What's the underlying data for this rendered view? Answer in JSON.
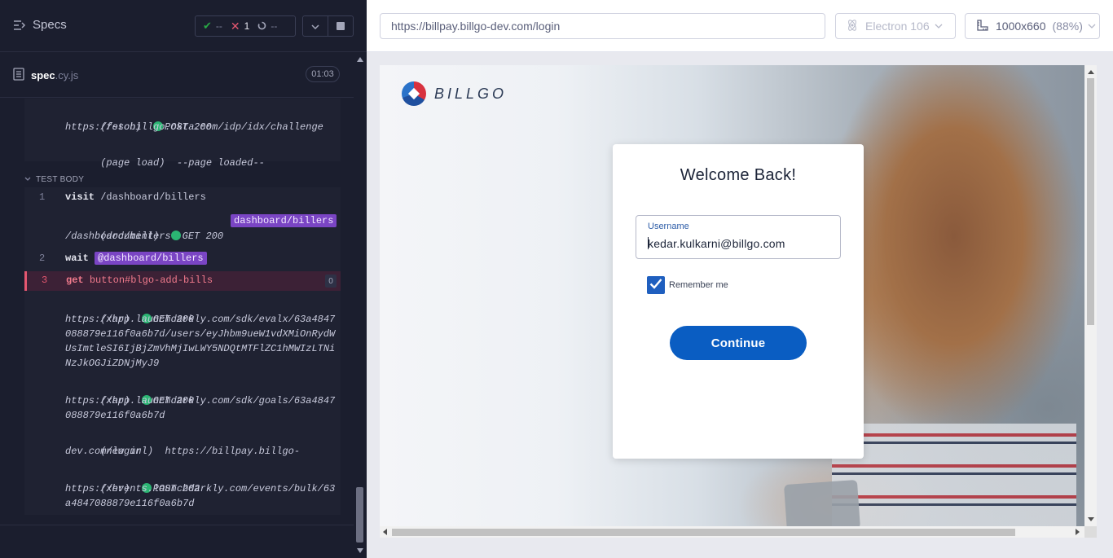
{
  "sidebar": {
    "title": "Specs",
    "stats": {
      "passed": "--",
      "failed": "1",
      "pending": "--"
    },
    "spec": {
      "name": "spec",
      "ext": ".cy.js",
      "duration": "01:03"
    }
  },
  "log": {
    "before": [
      {
        "type": "(fetch)",
        "method": "POST 200",
        "url": "https://ssobillgo.okta.com/idp/idx/challenge"
      },
      {
        "type": "(page load)",
        "message": "--page loaded--"
      }
    ],
    "section": "TEST BODY",
    "steps": [
      {
        "num": "1",
        "cmd": "visit",
        "arg": "/dashboard/billers"
      },
      {
        "type": "(document)",
        "method": "GET 200",
        "url": "/dashboard/billers",
        "alias": "dashboard/billers"
      },
      {
        "num": "2",
        "cmd": "wait",
        "arg": "@dashboard/billers"
      },
      {
        "num": "3",
        "cmd": "get",
        "arg": "button#blgo-add-bills",
        "count": "0",
        "failed": true
      },
      {
        "type": "(xhr)",
        "method": "GET 200",
        "url_lines": [
          "https://app.launchdarkly.com/sdk/evalx/63a4847",
          "088879e116f0a6b7d/users/eyJhbm9ueW1vdXMiOnRydW",
          "UsImtleSI6IjBjZmVhMjIwLWY5NDQtMTFlZC1hMWIzLTNi",
          "NzJkOGJiZDNjMyJ9"
        ]
      },
      {
        "type": "(xhr)",
        "method": "GET 200",
        "url_lines": [
          "https://app.launchdarkly.com/sdk/goals/63a4847",
          "088879e116f0a6b7d"
        ]
      },
      {
        "type": "(new url)",
        "url_lines": [
          "https://billpay.billgo-",
          "dev.com/login"
        ]
      },
      {
        "type": "(xhr)",
        "method": "POST 202",
        "url_lines": [
          "https://events.launchdarkly.com/events/bulk/63",
          "a4847088879e116f0a6b7d"
        ]
      }
    ]
  },
  "browser": {
    "url": "https://billpay.billgo-dev.com/login",
    "name": "Electron 106",
    "viewport": "1000x660",
    "zoom": "(88%)"
  },
  "app": {
    "logo_text": "BILLGO",
    "title": "Welcome Back!",
    "username_label": "Username",
    "username_value": "kedar.kulkarni@billgo.com",
    "remember_label": "Remember me",
    "remember_checked": true,
    "continue_label": "Continue"
  },
  "colors": {
    "panel_bg": "#1b1e2e",
    "pass": "#28a745",
    "fail": "#e45770",
    "alias": "#7a45c4",
    "primary_button": "#0a5dc2"
  }
}
